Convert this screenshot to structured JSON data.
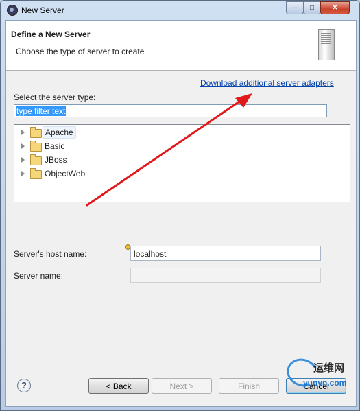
{
  "window": {
    "title": "New Server",
    "controls": {
      "minimize": "—",
      "maximize": "□",
      "close": "✕"
    }
  },
  "header": {
    "title": "Define a New Server",
    "description": "Choose the type of server to create",
    "image_icon": "server-icon"
  },
  "download_link": "Download additional server adapters",
  "server_type": {
    "label": "Select the server type:",
    "filter_value": "type filter text",
    "tree": [
      {
        "label": "Apache",
        "selected": true
      },
      {
        "label": "Basic"
      },
      {
        "label": "JBoss"
      },
      {
        "label": "ObjectWeb"
      }
    ]
  },
  "host": {
    "label": "Server's host name:",
    "value": "localhost"
  },
  "server_name": {
    "label": "Server name:",
    "value": ""
  },
  "buttons": {
    "back": "< Back",
    "next": "Next >",
    "finish": "Finish",
    "cancel": "Cancel"
  },
  "watermark": {
    "chinese": "运维网",
    "url": "yunvn.com"
  },
  "colors": {
    "arrow": "#e0191c",
    "link": "#0645ad",
    "selection": "#3399ff"
  }
}
